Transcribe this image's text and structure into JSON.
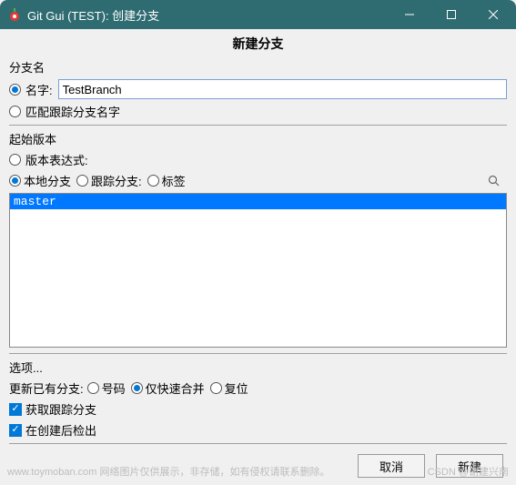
{
  "window": {
    "title": "Git Gui (TEST): 创建分支"
  },
  "header": "新建分支",
  "branch_name": {
    "section": "分支名",
    "radio_name": "名字:",
    "name_value": "TestBranch",
    "radio_match": "匹配跟踪分支名字"
  },
  "start_rev": {
    "section": "起始版本",
    "radio_expr": "版本表达式:",
    "radio_local": "本地分支",
    "radio_track": "跟踪分支:",
    "radio_tag": "标签",
    "list": [
      "master"
    ]
  },
  "options": {
    "section": "选项...",
    "update": {
      "label": "更新已有分支:",
      "no": "号码",
      "ffonly": "仅快速合并",
      "reset": "复位"
    },
    "fetch": "获取跟踪分支",
    "checkout": "在创建后检出"
  },
  "buttons": {
    "cancel": "取消",
    "create": "新建"
  },
  "watermark": {
    "left": "www.toymoban.com  网络图片仅供展示，非存储，如有侵权请联系删除。",
    "right": "CSDN @谢建兴南"
  }
}
